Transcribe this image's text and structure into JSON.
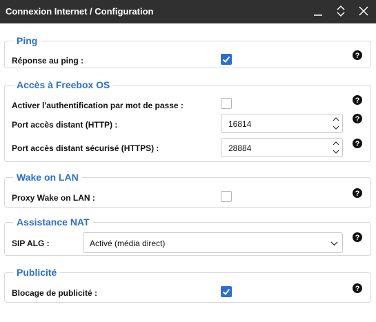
{
  "window": {
    "title": "Connexion Internet / Configuration"
  },
  "sections": {
    "ping": {
      "legend": "Ping",
      "response_label": "Réponse au ping :",
      "response_checked": true
    },
    "freebox_os": {
      "legend": "Accès à Freebox OS",
      "auth_label": "Activer l'authentification par mot de passe :",
      "auth_checked": false,
      "http_label": "Port accès distant (HTTP) :",
      "http_value": "16814",
      "https_label": "Port accès distant sécurisé (HTTPS) :",
      "https_value": "28884"
    },
    "wol": {
      "legend": "Wake on LAN",
      "proxy_label": "Proxy Wake on LAN :",
      "proxy_checked": false
    },
    "nat": {
      "legend": "Assistance NAT",
      "sip_label": "SIP ALG :",
      "sip_value": "Activé (média direct)"
    },
    "ads": {
      "legend": "Publicité",
      "block_label": "Blocage de publicité :",
      "block_checked": true
    }
  },
  "icons": {
    "minimize": "minimize-icon",
    "restore": "restore-icon",
    "close": "close-icon",
    "help": "help-icon",
    "check": "checkmark-icon"
  },
  "colors": {
    "titlebar": "#303030",
    "accent": "#2c6fd1",
    "border": "#d8d8d8"
  }
}
